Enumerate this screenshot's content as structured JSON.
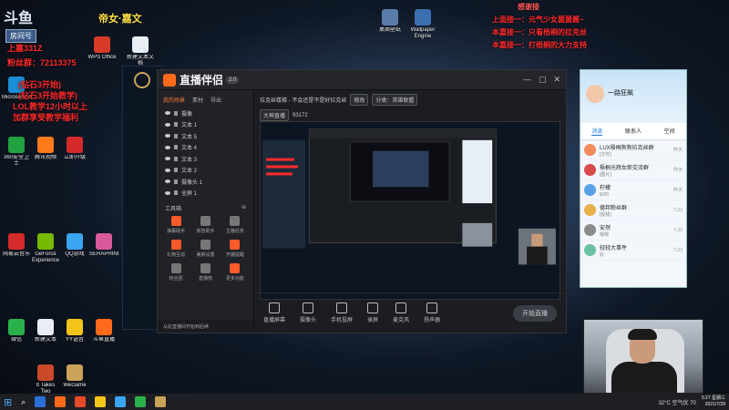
{
  "overlay": {
    "brand": "斗鱼",
    "room_label": "房间号",
    "title_yellow": "帝女·嘉文",
    "left_lines_red": [
      "上嘉331Z",
      "粉丝群：72113375",
      "(钻石3开始)",
      "(钻石3开始教学)",
      "LOL教学12小时以上",
      "加群享受教学福利"
    ],
    "right_label": "感谢接",
    "right_lines_red": [
      "上面接一：元气少女菌菌酱~",
      "本嘉接一：只看梧桐的拉克丝",
      "本嘉接一：打梧桐的大力支持"
    ]
  },
  "desktop_icons": [
    {
      "label": "MicrosoftEdge",
      "color": "#1a8fd8"
    },
    {
      "label": "WPS Office",
      "color": "#d83a2a"
    },
    {
      "label": "新建文本文档",
      "color": "#e9eef5"
    },
    {
      "label": "桌面壁纸",
      "color": "#5a7ca8"
    },
    {
      "label": "Wallpaper Engine",
      "color": "#3b6fb0"
    },
    {
      "label": "360安全卫士",
      "color": "#21a13f"
    },
    {
      "label": "腾讯视频",
      "color": "#ff7a1a"
    },
    {
      "label": "立即升级",
      "color": "#d42a2a"
    },
    {
      "label": "网易云音乐",
      "color": "#d42a2a"
    },
    {
      "label": "GeForce Experience",
      "color": "#76b900"
    },
    {
      "label": "QQ游戏",
      "color": "#3aa5f0"
    },
    {
      "label": "SERAPHINE",
      "color": "#d95a9a"
    },
    {
      "label": "微信",
      "color": "#2ab24a"
    },
    {
      "label": "新建文本",
      "color": "#e9eef5"
    },
    {
      "label": "YY语音",
      "color": "#f3c51a"
    },
    {
      "label": "斗鱼直播",
      "color": "#ff6a1a"
    },
    {
      "label": "It Takes Two",
      "color": "#c94a2a"
    },
    {
      "label": "WeGame",
      "color": "#c9a35a"
    }
  ],
  "app": {
    "name": "直播伴侣",
    "version": "2.0",
    "window_buttons": [
      "—",
      "▢",
      "✕"
    ],
    "left_tabs": [
      "我的场景",
      "素材",
      "导出"
    ],
    "sources": [
      "摄像",
      "文本 1",
      "文本 5",
      "文本 4",
      "文本 3",
      "文本 2",
      "摄像头 1",
      "全屏 1"
    ],
    "tools_label": "工具箱",
    "tools": [
      {
        "label": "弹幕助手",
        "grey": false
      },
      {
        "label": "房管助手",
        "grey": true
      },
      {
        "label": "主播任务",
        "grey": true
      },
      {
        "label": "礼物互动",
        "grey": false
      },
      {
        "label": "美颜设置",
        "grey": true
      },
      {
        "label": "开播提醒",
        "grey": false
      },
      {
        "label": "粉丝团",
        "grey": true
      },
      {
        "label": "直播榜",
        "grey": true
      },
      {
        "label": "更多功能",
        "grey": false
      }
    ],
    "footer": "从此直播间开始到后续",
    "info_title": "拉克丝楼梯 - 不会还是不是好拉克丝",
    "info_chip1": "修改",
    "info_chip2": "分类：英雄联盟",
    "info_chip3": "大神直播",
    "room_no": "93172",
    "bottom_buttons": [
      "直播屏幕",
      "摄像头",
      "手机投屏",
      "录屏",
      "麦克风",
      "扬声器"
    ],
    "go_live": "开始直播"
  },
  "qq": {
    "nickname": "一路狂飙",
    "tabs": [
      "消息",
      "联系人",
      "空间"
    ],
    "chats": [
      {
        "name": "LUX梧桐狗狗拉克丝群",
        "msg": "[文件]",
        "time": "昨天",
        "color": "#f28a5a"
      },
      {
        "name": "梧桐光辉女郎交流群",
        "msg": "[图片]",
        "time": "昨天",
        "color": "#d84a4a"
      },
      {
        "name": "柠檬",
        "msg": "好的",
        "time": "昨天",
        "color": "#5aa0e8"
      },
      {
        "name": "德邦粉丝群",
        "msg": "[视频]",
        "time": "7-22",
        "color": "#e8b04a"
      },
      {
        "name": "安然",
        "msg": "嗯嗯",
        "time": "7-22",
        "color": "#8a8a8a"
      },
      {
        "name": "轻轻大事件",
        "msg": "好",
        "time": "7-22",
        "color": "#6ac0a0"
      }
    ]
  },
  "taskbar": {
    "weather": "32°C 空气优 70",
    "time": "5:27 星期三",
    "date": "2021/7/28",
    "apps": [
      "#2b6fd6",
      "#ff6a1a",
      "#e84a2a",
      "#f3c51a",
      "#3aa5f0",
      "#2ab24a",
      "#c9a35a"
    ]
  }
}
